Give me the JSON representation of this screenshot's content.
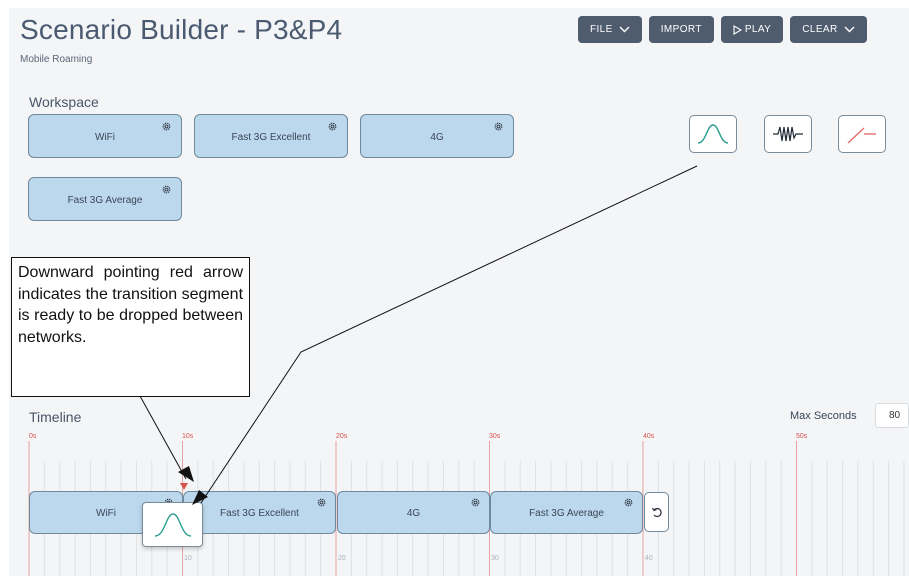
{
  "header": {
    "title": "Scenario Builder - P3&P4",
    "subtitle": "Mobile Roaming"
  },
  "toolbar": {
    "file_label": "FILE",
    "import_label": "IMPORT",
    "play_label": "PLAY",
    "clear_label": "CLEAR"
  },
  "workspace": {
    "label": "Workspace",
    "blocks": [
      {
        "label": "WiFi"
      },
      {
        "label": "Fast 3G Excellent"
      },
      {
        "label": "4G"
      },
      {
        "label": "Fast 3G Average"
      }
    ],
    "segment_tiles": [
      {
        "icon": "bell-curve-icon"
      },
      {
        "icon": "noise-wave-icon"
      },
      {
        "icon": "ramp-icon"
      }
    ]
  },
  "callout": {
    "text": "Downward pointing red arrow indicates the transition segment is ready to be dropped between networks."
  },
  "timeline": {
    "label": "Timeline",
    "max_seconds_label": "Max Seconds",
    "max_seconds_value": "80",
    "tick_labels_top": [
      "0s",
      "10s",
      "20s",
      "30s",
      "40s",
      "50s"
    ],
    "tick_labels_bottom": [
      "10",
      "20",
      "30",
      "40"
    ],
    "blocks": [
      {
        "label": "WiFi"
      },
      {
        "label": "Fast 3G Excellent"
      },
      {
        "label": "4G"
      },
      {
        "label": "Fast 3G Average"
      }
    ]
  },
  "colors": {
    "accent": "#4f5c6e",
    "block_fill": "#bcd8ec",
    "block_border": "#6f8aa0",
    "icon_teal": "#2a9d8f",
    "marker_red": "#d9534f"
  }
}
